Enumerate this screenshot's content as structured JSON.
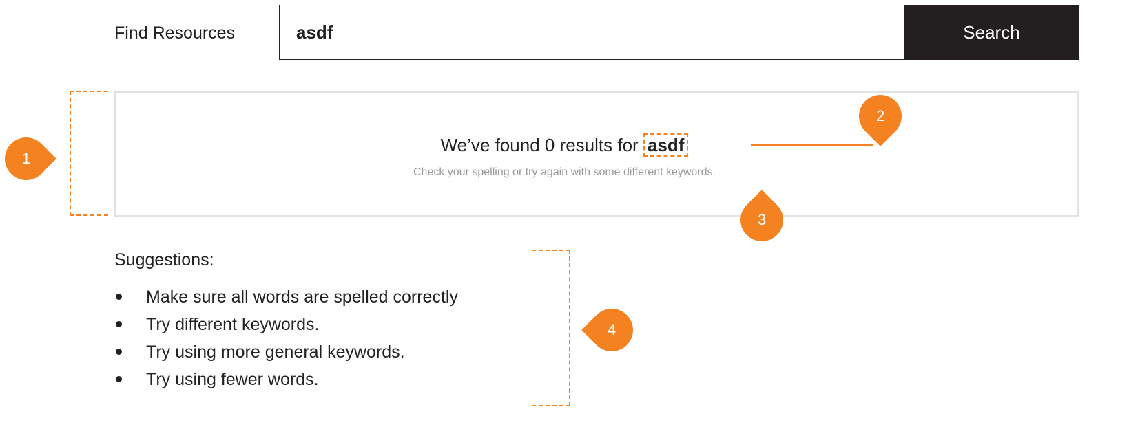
{
  "search": {
    "label": "Find Resources",
    "query": "asdf",
    "button_label": "Search"
  },
  "results": {
    "heading_prefix": "We’ve found 0 results for",
    "query": "asdf",
    "subtext": "Check your spelling or try again with some different keywords."
  },
  "suggestions": {
    "title": "Suggestions:",
    "items": [
      "Make sure all words are spelled correctly",
      "Try different keywords.",
      "Try using more general keywords.",
      "Try using fewer words."
    ]
  },
  "annotations": {
    "badges": [
      "1",
      "2",
      "3",
      "4"
    ],
    "accent_color": "#f58220"
  }
}
